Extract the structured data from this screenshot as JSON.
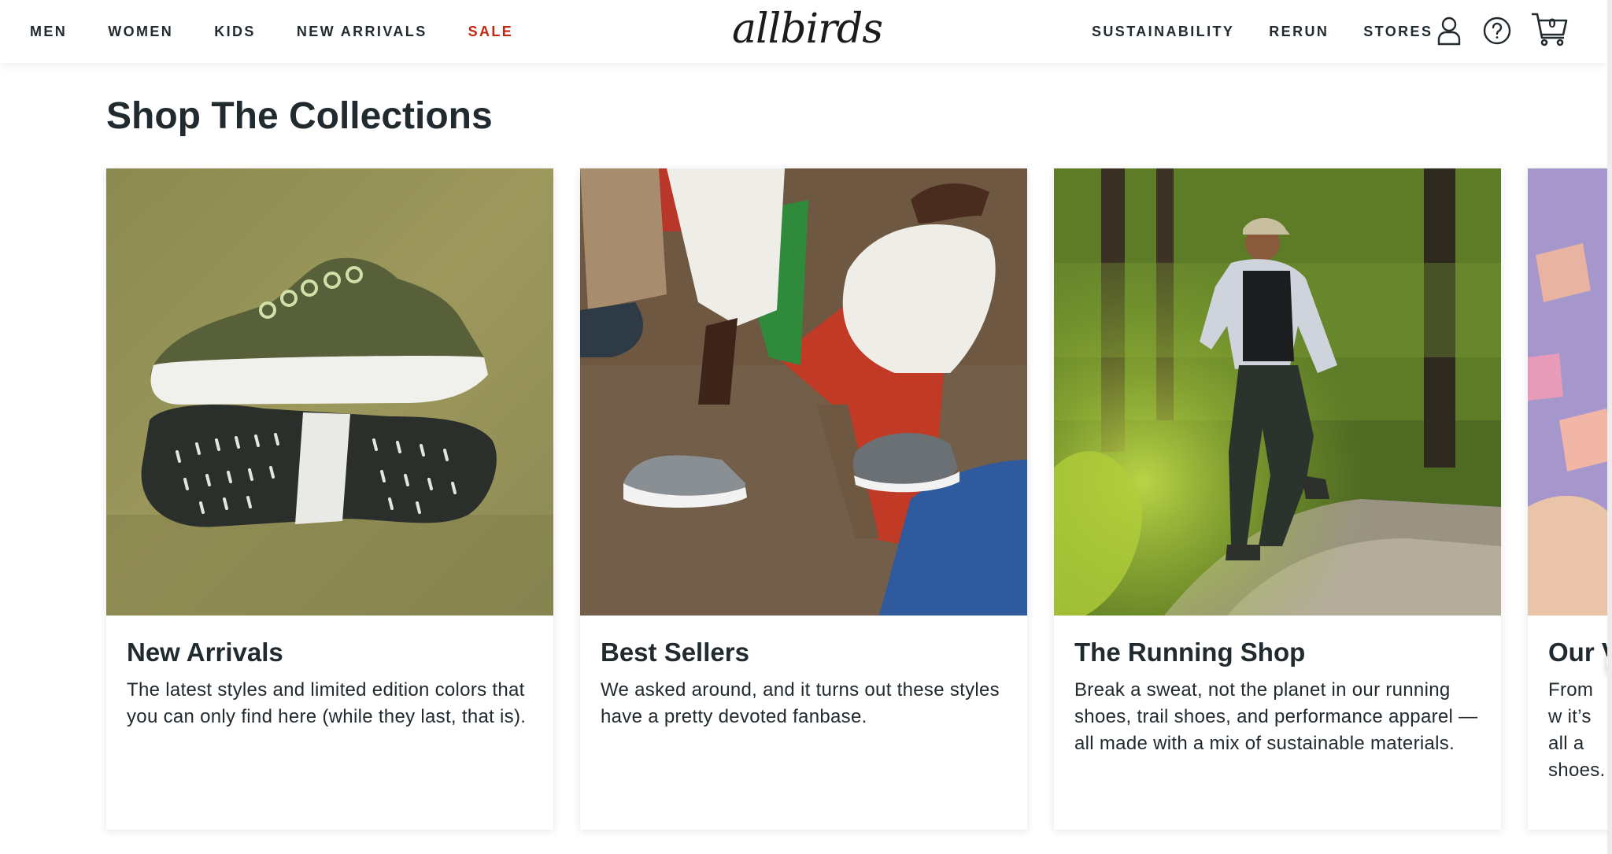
{
  "nav": {
    "left": [
      "MEN",
      "WOMEN",
      "KIDS",
      "NEW ARRIVALS",
      "SALE"
    ],
    "right": [
      "SUSTAINABILITY",
      "RERUN",
      "STORES"
    ],
    "sale_color": "#c3250f"
  },
  "logo": "allbirds",
  "icons": {
    "account": "user-icon",
    "help": "help-icon",
    "cart": "cart-icon"
  },
  "cart": {
    "count": "0"
  },
  "section": {
    "title": "Shop The Collections"
  },
  "cards": [
    {
      "title": "New Arrivals",
      "description": "The latest styles and limited edition colors that you can only find here (while they last, that is)."
    },
    {
      "title": "Best Sellers",
      "description": "We asked around, and it turns out these styles have a pretty devoted fanbase."
    },
    {
      "title": "The Running Shop",
      "description": "Break a sweat, not the planet in our running shoes, trail shoes, and performance apparel — all made with a mix of sustainable materials."
    },
    {
      "title": "Our V",
      "description": "From w it’s all a shoes."
    }
  ],
  "carousel": {
    "next_icon": "chevron-right-icon"
  }
}
